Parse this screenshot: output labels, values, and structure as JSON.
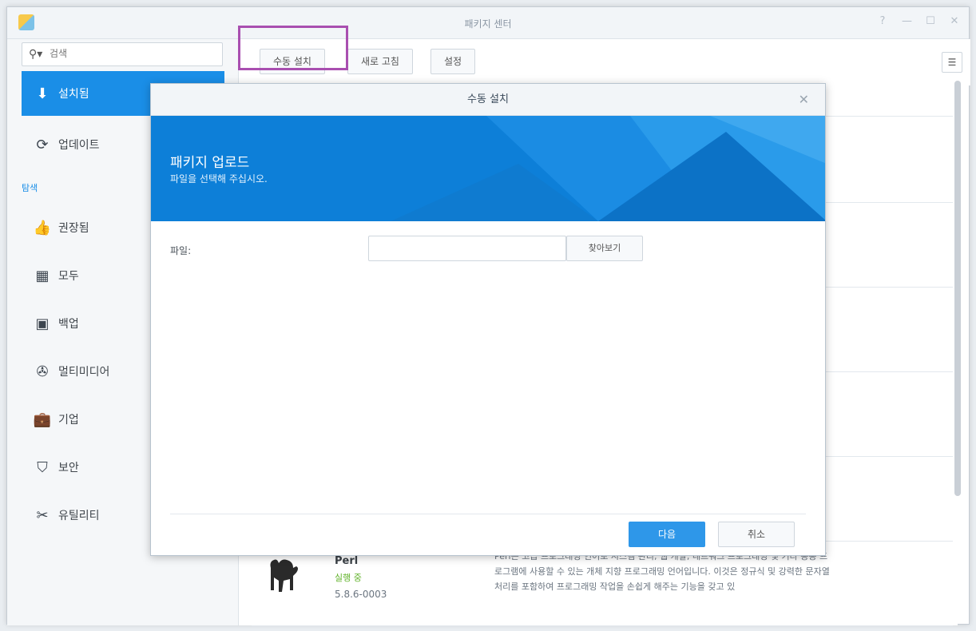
{
  "window": {
    "title": "패키지 센터",
    "controls": [
      "?",
      "—",
      "☐",
      "✕"
    ]
  },
  "search": {
    "placeholder": "검색"
  },
  "sidebar": {
    "items": [
      {
        "label": "설치됨",
        "icon": "download-icon",
        "active": true
      },
      {
        "label": "업데이트",
        "icon": "refresh-icon"
      }
    ],
    "section_label": "탐색",
    "browse_items": [
      {
        "label": "권장됨",
        "icon": "thumbs-up-icon"
      },
      {
        "label": "모두",
        "icon": "grid-icon"
      },
      {
        "label": "백업",
        "icon": "backup-icon"
      },
      {
        "label": "멀티미디어",
        "icon": "film-reel-icon"
      },
      {
        "label": "기업",
        "icon": "briefcase-icon"
      },
      {
        "label": "보안",
        "icon": "shield-icon"
      },
      {
        "label": "유틸리티",
        "icon": "tools-icon"
      }
    ]
  },
  "toolbar": {
    "manual_install": "수동 설치",
    "refresh": "새로 고침",
    "settings": "설정",
    "list_toggle": "☰"
  },
  "package": {
    "name": "Perl",
    "status": "실행 중",
    "version": "5.8.6-0003",
    "description": "Perl은 고급 프로그래밍 언어로 시스템 관리, 웹 개발, 네트워크 프로그래밍 및 기타 응용 프로그램에 사용할 수 있는 개체 지향 프로그래밍 언어입니다. 이것은 정규식 및 강력한 문자열 처리를 포함하여 프로그래밍 작업을 손쉽게 해주는 기능을 갖고 있"
  },
  "dialog": {
    "title": "수동 설치",
    "close": "✕",
    "banner_title": "패키지 업로드",
    "banner_subtitle": "파일을 선택해 주십시오.",
    "file_label": "파일:",
    "file_value": "",
    "browse": "찾아보기",
    "next": "다음",
    "cancel": "취소"
  },
  "colors": {
    "accent": "#1a8ee7",
    "highlight": "#a94fb0",
    "running": "#62b32b"
  }
}
